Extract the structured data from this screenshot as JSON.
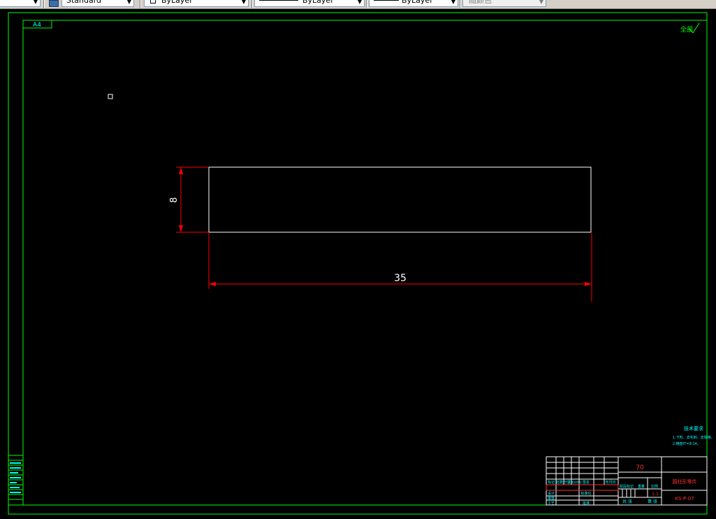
{
  "toolbar": {
    "style_value": "Standard",
    "layer_value": "ByLayer",
    "linetype_value": "ByLayer",
    "lineweight_value": "ByLayer",
    "color_value": "随颜色"
  },
  "drawing": {
    "corner_label": "A4",
    "surface_mark": "全部",
    "dimension_height": "8",
    "dimension_width": "35",
    "tech_requirements_title": "技术要求",
    "tech_requirements_line1": "1.下料、去毛刺、去锐棱。",
    "tech_requirements_line2": "2.精度IT=9-14。",
    "title_block": {
      "material": "70",
      "part_name": "圆柱形零件",
      "drawing_number": "KS-P-07",
      "scale": "1:1",
      "sheet_total": "共 张",
      "sheet_index": "第 张",
      "rev_headers": [
        "标记",
        "处数",
        "分区",
        "更改文件号",
        "签名",
        "年月日"
      ],
      "roles": [
        "设计",
        "审核",
        "工艺"
      ],
      "std_labels": [
        "标准化",
        "批准"
      ],
      "stage_headers": [
        "阶段标记",
        "重量",
        "比例"
      ]
    }
  },
  "colors": {
    "frame": "#00ff00",
    "dimension": "#ff0000",
    "geometry": "#ffffff",
    "text": "#00ffff",
    "title_red": "#ff3030"
  }
}
